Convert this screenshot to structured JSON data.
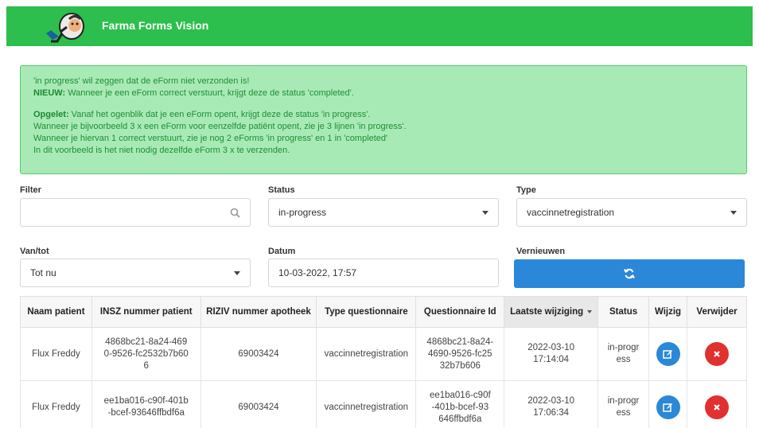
{
  "header": {
    "title": "Farma Forms Vision",
    "brand_color": "#2cbf4d"
  },
  "alert": {
    "line1": "'in progress' wil zeggen dat de eForm niet verzonden is!",
    "line2_bold": "NIEUW:",
    "line2_rest": " Wanneer je een eForm correct verstuurt, krijgt deze de status 'completed'.",
    "line3_bold": "Opgelet:",
    "line3_rest": " Vanaf het ogenblik dat je een eForm opent, krijgt deze de status 'in progress'.",
    "line4": "Wanneer je bijvoorbeeld 3 x een eForm voor eenzelfde patiënt opent, zie je 3 lijnen 'in progress'.",
    "line5": "Wanneer je hiervan 1 correct verstuurt, zie je nog 2 eForms 'in progress' en 1 in 'completed'",
    "line6": "In dit voorbeeld is het niet nodig dezelfde eForm 3 x te verzenden."
  },
  "filters": {
    "filter_label": "Filter",
    "filter_value": "",
    "status_label": "Status",
    "status_value": "in-progress",
    "type_label": "Type",
    "type_value": "vaccinnetregistration",
    "vantot_label": "Van/tot",
    "vantot_value": "Tot nu",
    "datum_label": "Datum",
    "datum_value": "10-03-2022, 17:57",
    "refresh_label": "Vernieuwen"
  },
  "table": {
    "headers": [
      "Naam patient",
      "INSZ nummer patient",
      "RIZIV nummer apotheek",
      "Type questionnaire",
      "Questionnaire Id",
      "Laatste wijziging",
      "Status",
      "Wijzig",
      "Verwijder"
    ],
    "rows": [
      {
        "name": "Flux Freddy",
        "insz": "4868bc21-8a24-4690-9526-fc2532b7b606",
        "riziv": "69003424",
        "type": "vaccinnetregistration",
        "qid": "4868bc21-8a24-4690-9526-fc2532b7b606",
        "date": "2022-03-10",
        "time": "17:14:04",
        "status": "in-progress"
      },
      {
        "name": "Flux Freddy",
        "insz": "ee1ba016-c90f-401b-bcef-93646ffbdf6a",
        "riziv": "69003424",
        "type": "vaccinnetregistration",
        "qid": "ee1ba016-c90f-401b-bcef-93646ffbdf6a",
        "date": "2022-03-10",
        "time": "17:06:34",
        "status": "in-progress"
      }
    ]
  },
  "icons": {
    "logo": "magnifier-mascot-logo",
    "search": "search-icon",
    "refresh": "refresh-icon",
    "edit": "edit-icon",
    "delete": "close-icon"
  }
}
